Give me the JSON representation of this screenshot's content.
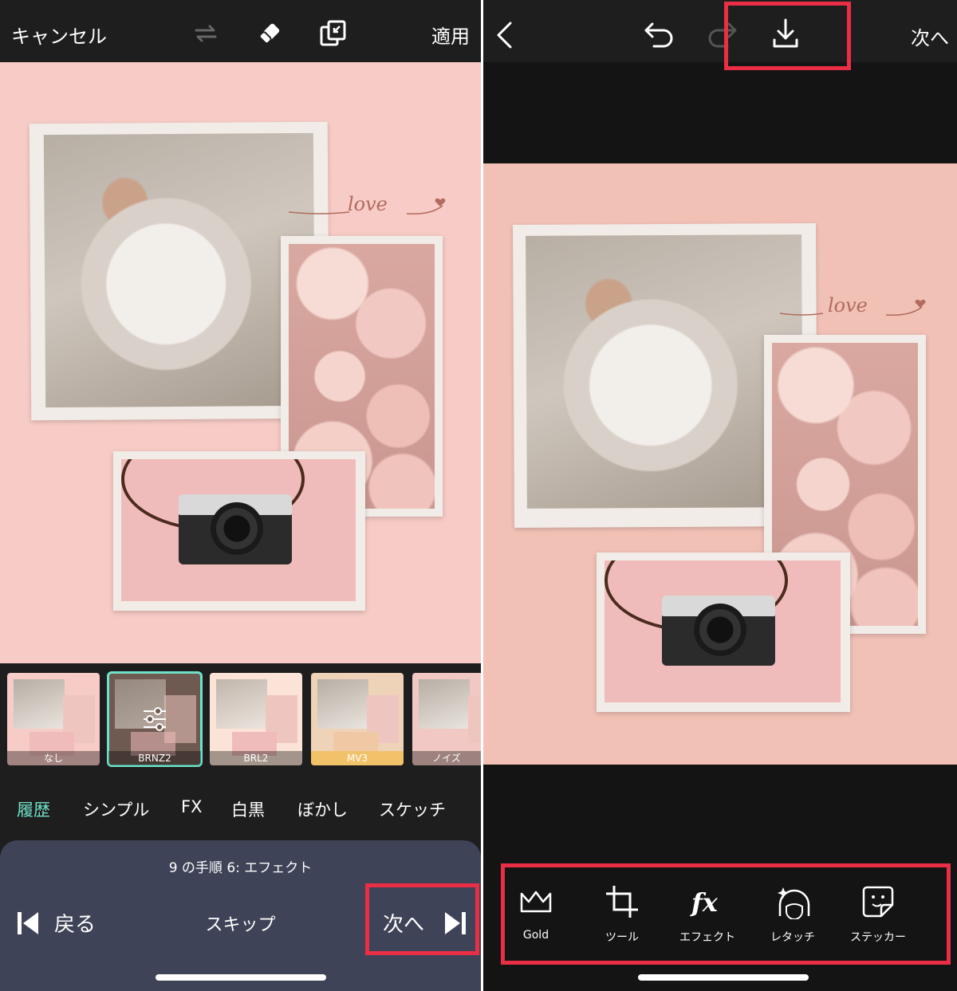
{
  "left": {
    "header": {
      "cancel": "キャンセル",
      "apply": "適用"
    },
    "canvas": {
      "love_text": "love"
    },
    "filters": [
      {
        "label": "なし",
        "selected": false
      },
      {
        "label": "BRNZ2",
        "selected": true
      },
      {
        "label": "BRL2",
        "selected": false
      },
      {
        "label": "MV3",
        "selected": false
      },
      {
        "label": "ノイズ",
        "selected": false
      }
    ],
    "categories": [
      "履歴",
      "シンプル",
      "FX",
      "白黒",
      "ぼかし",
      "スケッチ"
    ],
    "guide": {
      "step": "9 の手順 6: エフェクト",
      "back": "戻る",
      "skip": "スキップ",
      "next": "次へ"
    }
  },
  "right": {
    "header": {
      "next": "次へ"
    },
    "canvas": {
      "love_text": "love"
    },
    "tools": [
      {
        "label": "Gold",
        "icon": "crown-icon"
      },
      {
        "label": "ツール",
        "icon": "crop-icon"
      },
      {
        "label": "エフェクト",
        "icon": "fx-icon"
      },
      {
        "label": "レタッチ",
        "icon": "retouch-face-icon"
      },
      {
        "label": "ステッカー",
        "icon": "sticker-icon"
      }
    ]
  },
  "colors": {
    "highlight": "#ea2e45",
    "accent": "#6fe1c9",
    "canvas_pink": "#f7cbc6",
    "guide_bg": "#3e4357"
  }
}
